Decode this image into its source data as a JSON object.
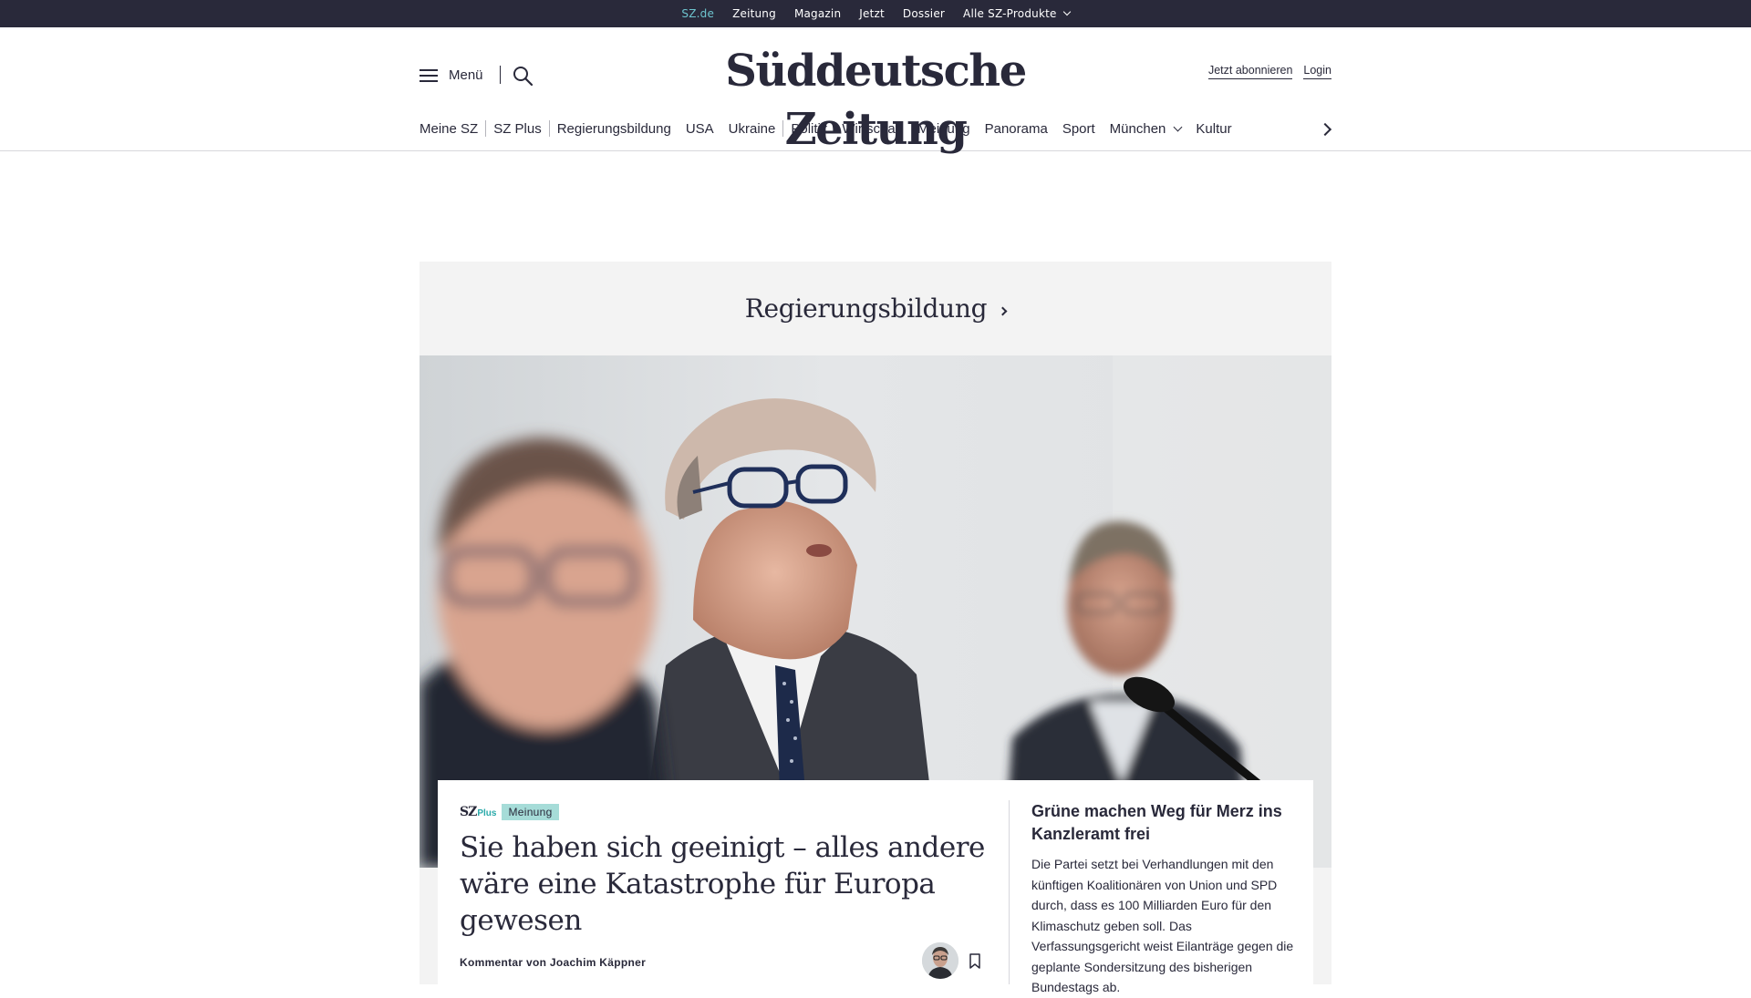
{
  "topbar": {
    "links": [
      "SZ.de",
      "Zeitung",
      "Magazin",
      "Jetzt",
      "Dossier",
      "Alle SZ-Produkte"
    ]
  },
  "header": {
    "menu_label": "Menü",
    "logo": "Süddeutsche Zeitung",
    "subscribe": "Jetzt abonnieren",
    "login": "Login"
  },
  "nav": {
    "items": [
      "Meine SZ",
      "SZ Plus",
      "Regierungsbildung",
      "USA",
      "Ukraine",
      "Politik",
      "Wirtschaft",
      "Meinung",
      "Panorama",
      "Sport",
      "München",
      "Kultur"
    ]
  },
  "section": {
    "title": "Regierungsbildung"
  },
  "lead_article": {
    "brand": "SZ",
    "brand_plus": "Plus",
    "tag": "Meinung",
    "headline": "Sie haben sich geeinigt – alles andere wäre eine Katastrophe für Europa gewesen",
    "byline": "Kommentar von Joachim Käppner"
  },
  "side_article": {
    "title": "Grüne machen Weg für Merz ins Kanzleramt frei",
    "teaser": "Die Partei setzt bei Verhandlungen mit den künftigen Koalitionären von Union und SPD durch, dass es 100 Milliarden Euro für den Klimaschutz geben soll. Das Verfassungsgericht weist Eilanträge gegen die geplante Sondersitzung des bisherigen Bundestags ab."
  },
  "colors": {
    "ink": "#29293a",
    "accent": "#6ec5cf",
    "tag_bg": "#a6dcd8",
    "section_bg": "#f3f3f3"
  }
}
